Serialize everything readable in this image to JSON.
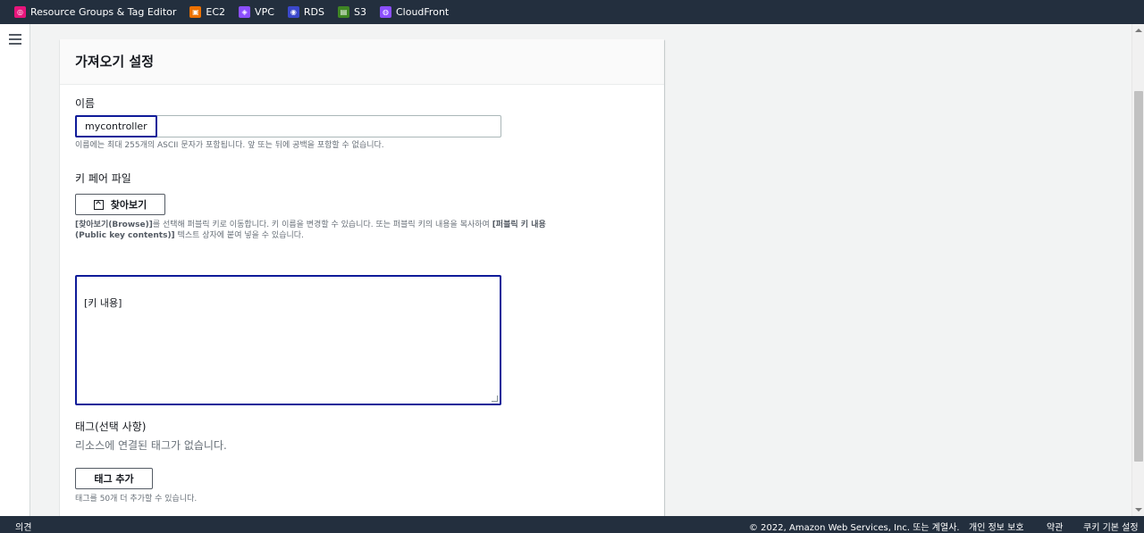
{
  "favorites": [
    {
      "label": "Resource Groups & Tag Editor",
      "icon": "resource-groups-icon",
      "color": "#e7157b",
      "glyph": "◎"
    },
    {
      "label": "EC2",
      "icon": "ec2-icon",
      "color": "#ed7100",
      "glyph": "▣"
    },
    {
      "label": "VPC",
      "icon": "vpc-icon",
      "color": "#8c4fff",
      "glyph": "◈"
    },
    {
      "label": "RDS",
      "icon": "rds-icon",
      "color": "#3b48cc",
      "glyph": "◉"
    },
    {
      "label": "S3",
      "icon": "s3-icon",
      "color": "#3f8624",
      "glyph": "▤"
    },
    {
      "label": "CloudFront",
      "icon": "cloudfront-icon",
      "color": "#8c4fff",
      "glyph": "◍"
    }
  ],
  "card": {
    "title": "가져오기 설정",
    "name_label": "이름",
    "name_value": "mycontroller",
    "name_hint": "이름에는 최대 255개의 ASCII 문자가 포함됩니다. 앞 또는 뒤에 공백을 포함할 수 없습니다.",
    "keyfile_label": "키 페어 파일",
    "browse_button": "찾아보기",
    "browse_hint_1a": "[찾아보기(Browse)]",
    "browse_hint_1b": "를 선택해 퍼블릭 키로 이동합니다. 키 이름을 변경할 수 있습니다. 또는 퍼블릭 키의 내용을 복사하여 ",
    "browse_hint_1c": "[퍼블릭 키 내용",
    "browse_hint_2a": "(Public key contents)]",
    "browse_hint_2b": " 텍스트 상자에 붙여 넣을 수 있습니다.",
    "key_content": "[키 내용]",
    "tags_label": "태그(선택 사항)",
    "tags_empty": "리소스에 연결된 태그가 없습니다.",
    "add_tag_button": "태그 추가",
    "tags_hint": "태그를 50개 더 추가할 수 있습니다."
  },
  "footer": {
    "feedback": "의견",
    "copyright": "© 2022, Amazon Web Services, Inc. 또는 계열사.",
    "privacy": "개인 정보 보호",
    "terms": "약관",
    "cookies": "쿠키 기본 설정"
  },
  "colors": {
    "nav_bg": "#232f3e",
    "focus_border": "#0f1b99",
    "page_bg": "#f2f3f3"
  }
}
